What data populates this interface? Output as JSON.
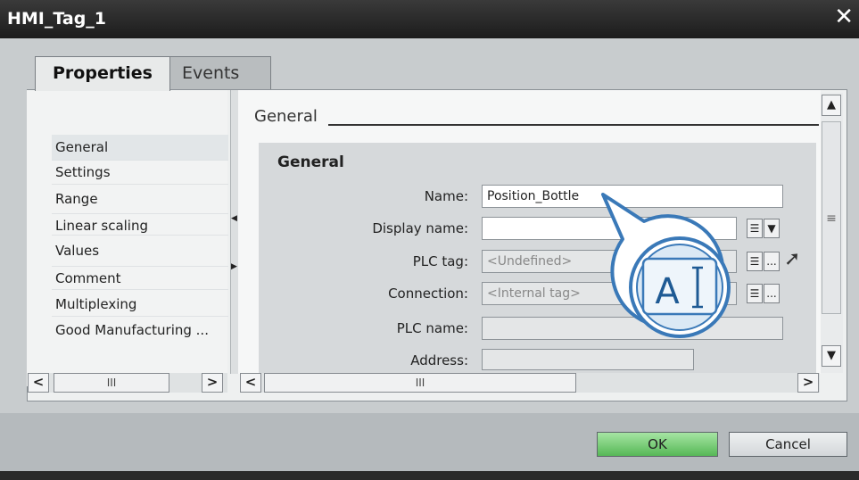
{
  "window": {
    "title": "HMI_Tag_1",
    "close_glyph": "✕"
  },
  "tabs": [
    {
      "label": "Properties",
      "active": true
    },
    {
      "label": "Events",
      "active": false
    }
  ],
  "nav": {
    "items": [
      "General",
      "Settings",
      "Range",
      "Linear scaling",
      "Values",
      "Comment",
      "Multiplexing",
      "Good Manufacturing ..."
    ],
    "selected": "General"
  },
  "content": {
    "section_label": "General",
    "group_title": "General",
    "fields": {
      "name": {
        "label": "Name:",
        "value": "Position_Bottle"
      },
      "display_name": {
        "label": "Display name:",
        "value": ""
      },
      "plc_tag": {
        "label": "PLC tag:",
        "value": "<Undefined>"
      },
      "connection": {
        "label": "Connection:",
        "value": "<Internal tag>"
      },
      "plc_name": {
        "label": "PLC name:",
        "value": ""
      },
      "address": {
        "label": "Address:",
        "value": ""
      }
    },
    "ellipsis": "...",
    "dropdown_glyph": "▼",
    "list_glyph": "☰"
  },
  "scrollbars": {
    "left_arrow": "<",
    "right_arrow": ">",
    "up_arrow": "▲",
    "down_arrow": "▼",
    "thumb_grip": "III",
    "vthumb_grip": "≡"
  },
  "callout": {
    "glyph": "A"
  },
  "buttons": {
    "ok": "OK",
    "cancel": "Cancel"
  },
  "colors": {
    "ok_green": "#6cc96a",
    "callout_blue": "#3a79b8",
    "title_bar": "#2a2a2a"
  }
}
